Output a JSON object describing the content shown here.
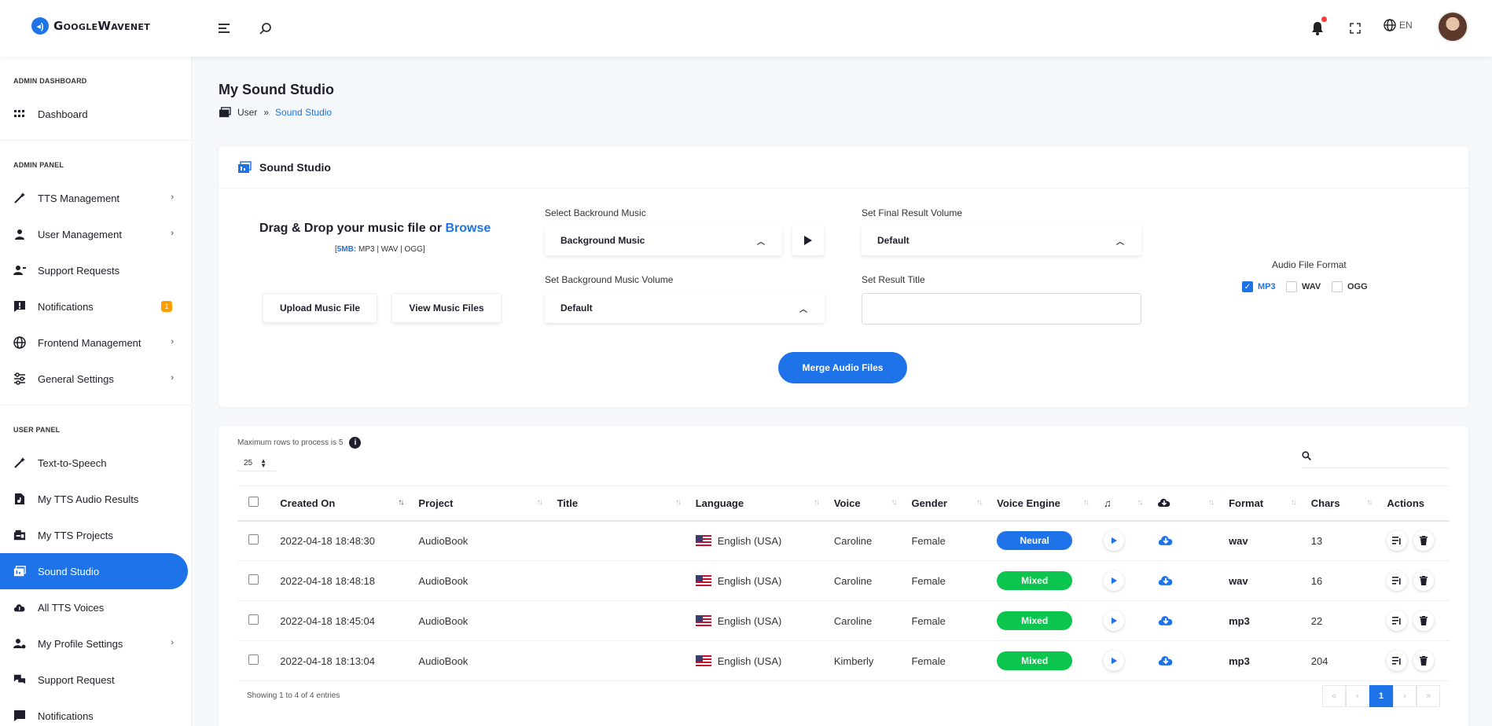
{
  "brand": {
    "logo_text": "GoogleWavenet"
  },
  "topbar": {
    "language": "EN"
  },
  "sidebar": {
    "sections": [
      {
        "heading": "ADMIN DASHBOARD",
        "items": [
          {
            "label": "Dashboard"
          }
        ]
      },
      {
        "heading": "ADMIN PANEL",
        "items": [
          {
            "label": "TTS Management"
          },
          {
            "label": "User Management"
          },
          {
            "label": "Support Requests"
          },
          {
            "label": "Notifications",
            "badge": "1"
          },
          {
            "label": "Frontend Management"
          },
          {
            "label": "General Settings"
          }
        ]
      },
      {
        "heading": "USER PANEL",
        "items": [
          {
            "label": "Text-to-Speech"
          },
          {
            "label": "My TTS Audio Results"
          },
          {
            "label": "My TTS Projects"
          },
          {
            "label": "Sound Studio"
          },
          {
            "label": "All TTS Voices"
          },
          {
            "label": "My Profile Settings"
          },
          {
            "label": "Support Request"
          },
          {
            "label": "Notifications"
          }
        ]
      }
    ]
  },
  "page": {
    "title": "My Sound Studio",
    "breadcrumb": {
      "root": "User",
      "current": "Sound Studio",
      "separator": "»"
    }
  },
  "studio": {
    "card_title": "Sound Studio",
    "drop_title": "Drag & Drop your music file or ",
    "browse_label": "Browse",
    "size_limit": "5MB:",
    "formats_hint": " MP3 | WAV | OGG",
    "upload_label": "Upload Music File",
    "view_label": "View Music Files",
    "bg_music_label": "Select Backround Music",
    "bg_music_value": "Background Music",
    "bg_volume_label": "Set Background Music Volume",
    "bg_volume_value": "Default",
    "final_volume_label": "Set Final Result Volume",
    "final_volume_value": "Default",
    "result_title_label": "Set Result Title",
    "result_title_value": "",
    "format_title": "Audio File Format",
    "formats": [
      {
        "label": "MP3",
        "checked": true
      },
      {
        "label": "WAV",
        "checked": false
      },
      {
        "label": "OGG",
        "checked": false
      }
    ],
    "merge_label": "Merge Audio Files"
  },
  "results": {
    "max_rows_note": "Maximum rows to process is 5",
    "page_length": "25",
    "columns": [
      "Created On",
      "Project",
      "Title",
      "Language",
      "Voice",
      "Gender",
      "Voice Engine",
      "",
      "",
      "Format",
      "Chars",
      "Actions"
    ],
    "rows": [
      {
        "created": "2022-04-18 18:48:30",
        "project": "AudioBook",
        "title": "",
        "language": "English (USA)",
        "voice": "Caroline",
        "gender": "Female",
        "engine": "Neural",
        "format": "wav",
        "chars": "13"
      },
      {
        "created": "2022-04-18 18:48:18",
        "project": "AudioBook",
        "title": "",
        "language": "English (USA)",
        "voice": "Caroline",
        "gender": "Female",
        "engine": "Mixed",
        "format": "wav",
        "chars": "16"
      },
      {
        "created": "2022-04-18 18:45:04",
        "project": "AudioBook",
        "title": "",
        "language": "English (USA)",
        "voice": "Caroline",
        "gender": "Female",
        "engine": "Mixed",
        "format": "mp3",
        "chars": "22"
      },
      {
        "created": "2022-04-18 18:13:04",
        "project": "AudioBook",
        "title": "",
        "language": "English (USA)",
        "voice": "Kimberly",
        "gender": "Female",
        "engine": "Mixed",
        "format": "mp3",
        "chars": "204"
      }
    ],
    "showing": "Showing 1 to 4 of 4 entries",
    "pagination": {
      "current": "1"
    }
  },
  "colors": {
    "accent": "#1e73e8",
    "neural": "#1e73e8",
    "mixed": "#0bc54e",
    "badge": "#ff9d00"
  }
}
